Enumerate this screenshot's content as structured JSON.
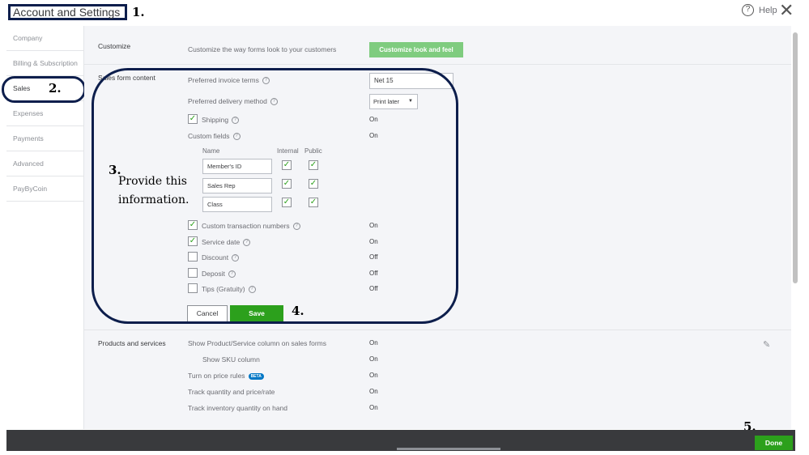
{
  "header": {
    "title": "Account and Settings",
    "help_label": "Help",
    "help_icon": "?",
    "close_icon": "✕"
  },
  "annotations": {
    "step1": "1.",
    "step2": "2.",
    "step3": "3.",
    "step4": "4.",
    "step5": "5.",
    "instruction_line1": "Provide this",
    "instruction_line2": "information."
  },
  "sidebar": {
    "items": [
      {
        "label": "Company"
      },
      {
        "label": "Billing & Subscription"
      },
      {
        "label": "Sales"
      },
      {
        "label": "Expenses"
      },
      {
        "label": "Payments"
      },
      {
        "label": "Advanced"
      },
      {
        "label": "PayByCoin"
      }
    ]
  },
  "customize": {
    "label": "Customize",
    "description": "Customize the way forms look to your customers",
    "button": "Customize look and feel"
  },
  "sales_form_content": {
    "label": "Sales form content",
    "invoice_terms_label": "Preferred invoice terms",
    "invoice_terms_value": "Net 15",
    "delivery_method_label": "Preferred delivery method",
    "delivery_method_value": "Print later",
    "shipping_label": "Shipping",
    "shipping_value": "On",
    "custom_fields_label": "Custom fields",
    "custom_fields_value": "On",
    "col_name": "Name",
    "col_internal": "Internal",
    "col_public": "Public",
    "custom_field_rows": [
      {
        "name": "Member's ID"
      },
      {
        "name": "Sales Rep"
      },
      {
        "name": "Class"
      }
    ],
    "custom_txn_label": "Custom transaction numbers",
    "custom_txn_value": "On",
    "service_date_label": "Service date",
    "service_date_value": "On",
    "discount_label": "Discount",
    "discount_value": "Off",
    "deposit_label": "Deposit",
    "deposit_value": "Off",
    "tips_label": "Tips (Gratuity)",
    "tips_value": "Off",
    "cancel_button": "Cancel",
    "save_button": "Save"
  },
  "products_services": {
    "label": "Products and services",
    "show_col_label": "Show Product/Service column on sales forms",
    "show_col_value": "On",
    "show_sku_label": "Show SKU column",
    "show_sku_value": "On",
    "price_rules_label": "Turn on price rules",
    "price_rules_badge": "BETA",
    "price_rules_value": "On",
    "track_qty_label": "Track quantity and price/rate",
    "track_qty_value": "On",
    "track_inv_label": "Track inventory quantity on hand",
    "track_inv_value": "On"
  },
  "footer": {
    "done_button": "Done"
  },
  "colors": {
    "accent_green": "#2ca01c",
    "annotation_navy": "#0d1e4c",
    "footer_bg": "#393a3d"
  }
}
